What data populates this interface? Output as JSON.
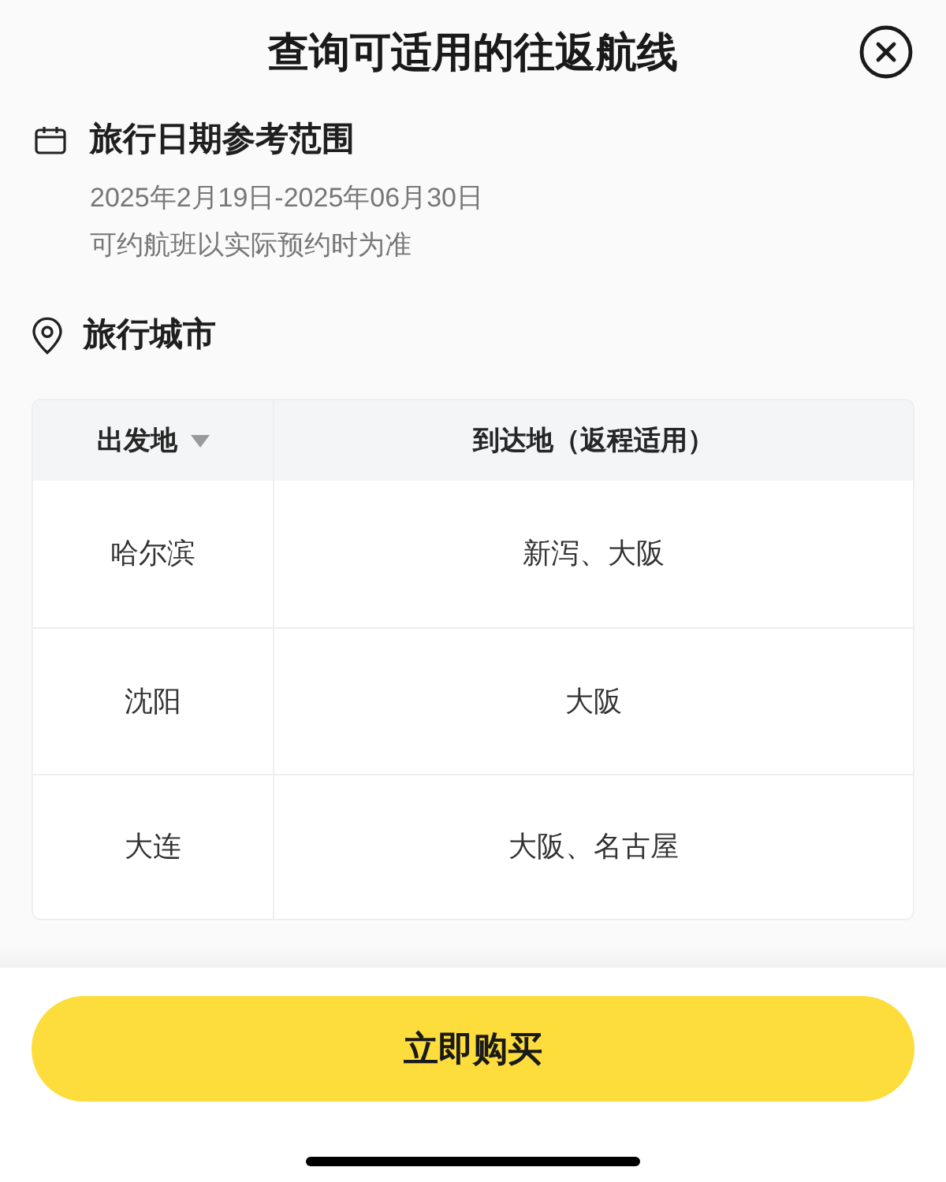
{
  "header": {
    "title": "查询可适用的往返航线"
  },
  "date_section": {
    "heading": "旅行日期参考范围",
    "range": "2025年2月19日-2025年06月30日",
    "note": "可约航班以实际预约时为准"
  },
  "city_section": {
    "heading": "旅行城市",
    "table": {
      "columns": [
        {
          "label": "出发地",
          "sortable": true
        },
        {
          "label": "到达地（返程适用）",
          "sortable": false
        }
      ],
      "rows": [
        [
          "哈尔滨",
          "新泻、大阪"
        ],
        [
          "沈阳",
          "大阪"
        ],
        [
          "大连",
          "大阪、名古屋"
        ]
      ]
    }
  },
  "buy_button": {
    "label": "立即购买"
  }
}
